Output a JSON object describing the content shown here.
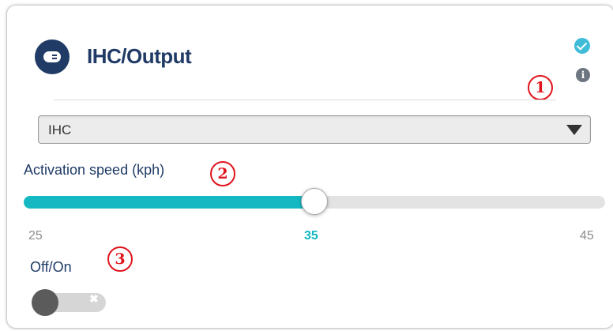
{
  "header": {
    "title": "IHC/Output",
    "app_icon": "output-icon",
    "status_icon": "check-circle-icon",
    "info_icon": "info-icon",
    "info_glyph": "i"
  },
  "annotations": {
    "marker_1": "1",
    "marker_2": "2",
    "marker_3": "3",
    "color": "#e0141c"
  },
  "select": {
    "value": "IHC",
    "icon": "dropdown-arrow-icon"
  },
  "slider": {
    "label": "Activation speed (kph)",
    "min": 25,
    "max": 45,
    "value": 35,
    "min_label": "25",
    "value_label": "35",
    "max_label": "45",
    "accent": "#14b8c2"
  },
  "toggle": {
    "label": "Off/On",
    "state": "off",
    "off_glyph": "✖"
  },
  "colors": {
    "brand": "#1f3b66",
    "check": "#40bcd8"
  }
}
